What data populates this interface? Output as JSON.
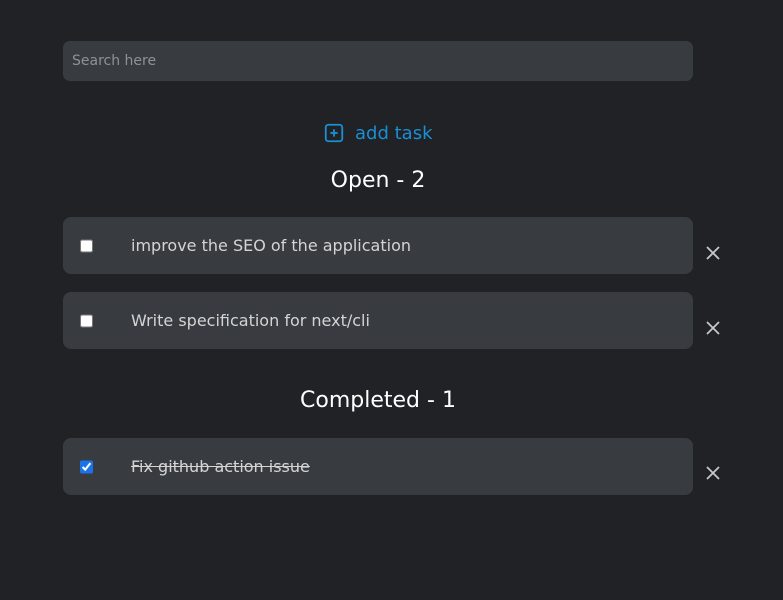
{
  "search": {
    "placeholder": "Search here",
    "value": ""
  },
  "add_task": {
    "label": "add task",
    "icon": "plus-square-icon",
    "color": "#1a8fd4"
  },
  "sections": {
    "open": {
      "title": "Open - 2",
      "tasks": [
        {
          "label": "improve the SEO of the application",
          "checked": false
        },
        {
          "label": "Write specification for next/cli",
          "checked": false
        }
      ]
    },
    "completed": {
      "title": "Completed - 1",
      "tasks": [
        {
          "label": "Fix github action issue",
          "checked": true
        }
      ]
    }
  },
  "colors": {
    "background": "#202225",
    "card": "#383c41",
    "accent": "#1a8fd4"
  },
  "delete_icon": "close-icon"
}
